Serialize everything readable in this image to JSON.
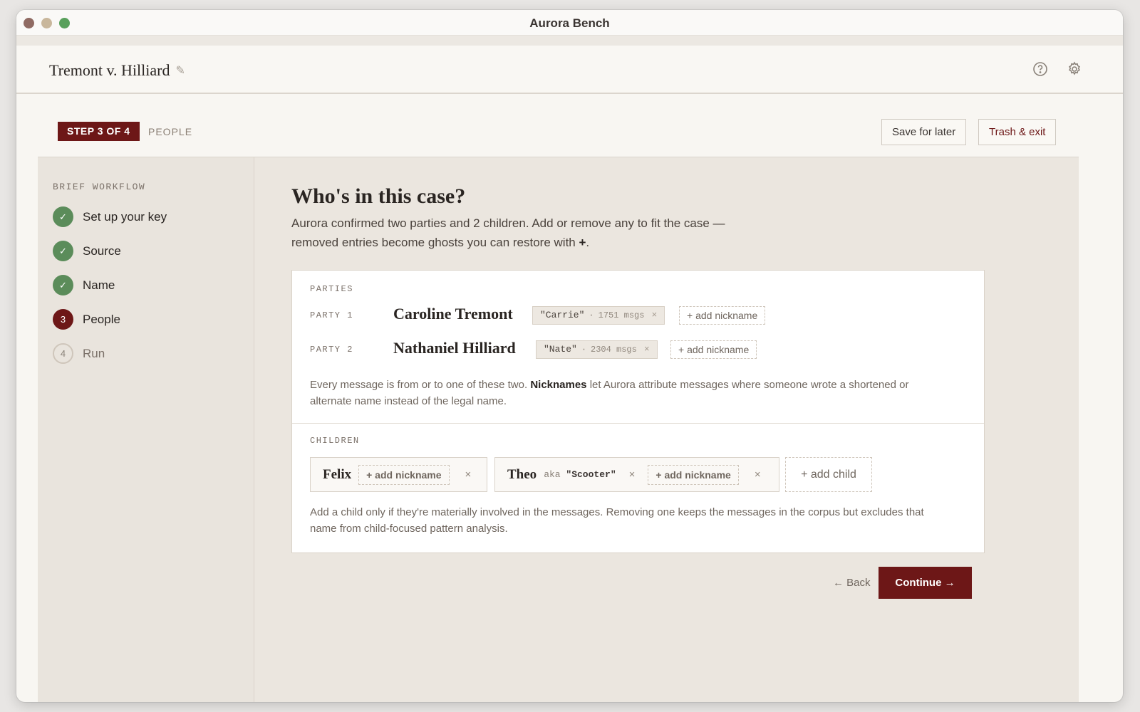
{
  "window": {
    "title": "Aurora Bench"
  },
  "header": {
    "case_title": "Tremont v. Hilliard",
    "icons": [
      "pencil-icon",
      "help-icon",
      "gear-icon"
    ]
  },
  "stepbar": {
    "badge": "STEP 3 OF 4",
    "step_name": "PEOPLE",
    "save_label": "Save for later",
    "trash_label": "Trash & exit"
  },
  "sidebar": {
    "heading": "BRIEF WORKFLOW",
    "items": [
      {
        "label": "Set up your key",
        "state": "done",
        "marker": "✓"
      },
      {
        "label": "Source",
        "state": "done",
        "marker": "✓"
      },
      {
        "label": "Name",
        "state": "done",
        "marker": "✓"
      },
      {
        "label": "People",
        "state": "active",
        "marker": "3"
      },
      {
        "label": "Run",
        "state": "todo",
        "marker": "4"
      }
    ]
  },
  "main": {
    "title": "Who's in this case?",
    "desc_part1": "Aurora confirmed two parties and 2 children. Add or remove any to fit the case — removed entries become ghosts you can restore with ",
    "desc_plus": "+",
    "desc_end": "."
  },
  "parties": {
    "label": "PARTIES",
    "items": [
      {
        "label": "PARTY 1",
        "name": "Caroline Tremont",
        "nickname": "\"Carrie\"",
        "msgs": "1751 msgs",
        "add_label": "+ add nickname"
      },
      {
        "label": "PARTY 2",
        "name": "Nathaniel Hilliard",
        "nickname": "\"Nate\"",
        "msgs": "2304 msgs",
        "add_label": "+ add nickname"
      }
    ],
    "note_pre": "Every message is from or to one of these two. ",
    "note_bold": "Nicknames",
    "note_post": " let Aurora attribute messages where someone wrote a shortened or alternate name instead of the legal name."
  },
  "children": {
    "label": "CHILDREN",
    "items": [
      {
        "name": "Felix",
        "aka": "",
        "alias": "",
        "add_label": "+ add nickname"
      },
      {
        "name": "Theo",
        "aka": "aka",
        "alias": "\"Scooter\"",
        "add_label": "+ add nickname"
      }
    ],
    "add_child_label": "+ add child",
    "note": "Add a child only if they're materially involved in the messages. Removing one keeps the messages in the corpus but excludes that name from child-focused pattern analysis."
  },
  "footer": {
    "back_label": "← Back",
    "continue_label": "Continue →"
  },
  "glyphs": {
    "x": "×",
    "sep": "·"
  },
  "colors": {
    "accent": "#6d1717",
    "done": "#5b8c5a"
  }
}
